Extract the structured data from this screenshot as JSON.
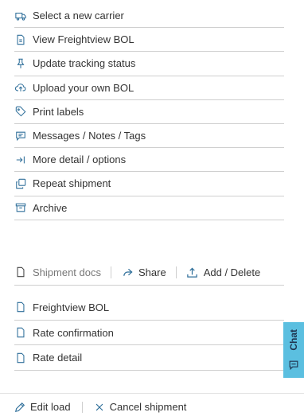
{
  "actions": [
    {
      "label": "Select a new carrier",
      "icon": "truck-icon"
    },
    {
      "label": "View Freightview BOL",
      "icon": "document-icon"
    },
    {
      "label": "Update tracking status",
      "icon": "pin-icon"
    },
    {
      "label": "Upload your own BOL",
      "icon": "cloud-upload-icon"
    },
    {
      "label": "Print labels",
      "icon": "tag-icon"
    },
    {
      "label": "Messages / Notes / Tags",
      "icon": "message-icon"
    },
    {
      "label": "More detail / options",
      "icon": "arrow-right-to-line-icon"
    },
    {
      "label": "Repeat shipment",
      "icon": "copy-icon"
    },
    {
      "label": "Archive",
      "icon": "archive-icon"
    }
  ],
  "docs": {
    "title": "Shipment docs",
    "share_label": "Share",
    "add_delete_label": "Add / Delete",
    "items": [
      "Freightview BOL",
      "Rate confirmation",
      "Rate detail"
    ]
  },
  "chat": {
    "label": "Chat"
  },
  "footer": {
    "edit_label": "Edit load",
    "cancel_label": "Cancel shipment"
  },
  "colors": {
    "accent": "#5bbfe0",
    "icon": "#2f6f9a",
    "divider": "#cfcfcf",
    "text": "#333333"
  }
}
